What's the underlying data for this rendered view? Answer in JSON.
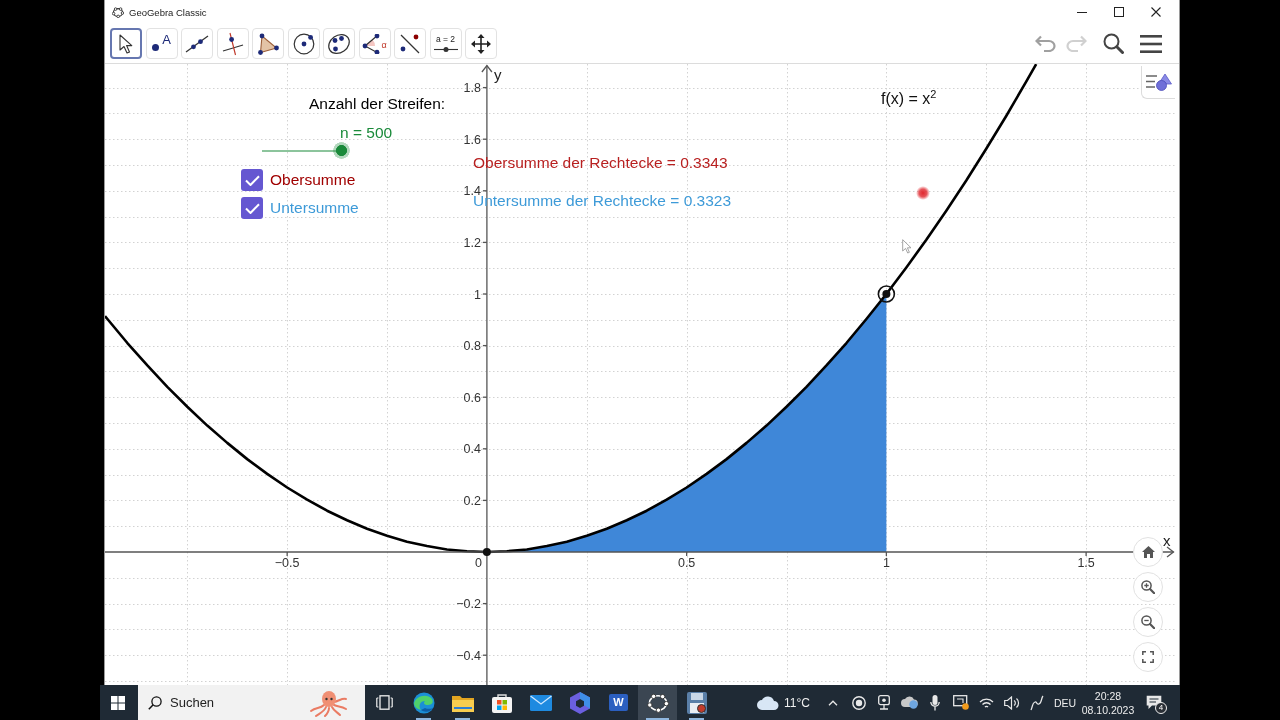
{
  "window": {
    "title": "GeoGebra Classic"
  },
  "toolbar": {
    "tools": [
      {
        "kind": "move",
        "selected": true
      },
      {
        "kind": "point",
        "icon_text": "A",
        "selected": false
      },
      {
        "kind": "line",
        "selected": false
      },
      {
        "kind": "perpendicular",
        "selected": false
      },
      {
        "kind": "polygon",
        "selected": false
      },
      {
        "kind": "circle",
        "selected": false
      },
      {
        "kind": "conic",
        "selected": false
      },
      {
        "kind": "angle",
        "icon_text": "α",
        "selected": false
      },
      {
        "kind": "reflect",
        "selected": false
      },
      {
        "kind": "slider",
        "icon_text": "a = 2",
        "selected": false
      },
      {
        "kind": "pan",
        "selected": false
      }
    ],
    "undo": {
      "disabled": false
    },
    "redo": {
      "disabled": true
    }
  },
  "graphics": {
    "objects": [
      {
        "kind": "text",
        "text": "Anzahl der Streifen:",
        "color": "#000000"
      },
      {
        "kind": "slider",
        "label": "n = 500",
        "level": 1,
        "color": "#1a8a3a"
      },
      {
        "kind": "checkbox",
        "label": "Obersumme",
        "checked": true,
        "color": "#a00000"
      },
      {
        "kind": "checkbox",
        "label": "Untersumme",
        "checked": true,
        "color": "#3d9ad8"
      },
      {
        "kind": "text",
        "text": "Obersumme der Rechtecke = 0.3343",
        "color": "#b82020"
      },
      {
        "kind": "text",
        "text": "Untersumme der Rechtecke = 0.3323",
        "color": "#3d9ad8"
      }
    ],
    "origin_label": "0",
    "chart_data": {
      "type": "line",
      "xlabel": "x",
      "ylabel": "y",
      "grid": true,
      "x": [
        -0.956,
        -0.95,
        -0.9,
        -0.85,
        -0.8,
        -0.75,
        -0.7,
        -0.65,
        -0.6,
        -0.55,
        -0.5,
        -0.45,
        -0.4,
        -0.35,
        -0.3,
        -0.25,
        -0.2,
        -0.15,
        -0.1,
        -0.05,
        0,
        0.05,
        0.1,
        0.15,
        0.2,
        0.25,
        0.3,
        0.35,
        0.4,
        0.45,
        0.5,
        0.55,
        0.6,
        0.65,
        0.7,
        0.75,
        0.8,
        0.85,
        0.9,
        0.95,
        1,
        1.05,
        1.1,
        1.15,
        1.2,
        1.25,
        1.3,
        1.35,
        1.375
      ],
      "series": [
        {
          "name": "f(x) = x$^{2}$",
          "type": "line",
          "color": "#000000",
          "values": [
            0.914,
            0.903,
            0.81,
            0.723,
            0.64,
            0.563,
            0.49,
            0.423,
            0.36,
            0.303,
            0.25,
            0.203,
            0.16,
            0.123,
            0.09,
            0.063,
            0.04,
            0.023,
            0.01,
            0.003,
            0,
            0.003,
            0.01,
            0.023,
            0.04,
            0.063,
            0.09,
            0.123,
            0.16,
            0.203,
            0.25,
            0.303,
            0.36,
            0.423,
            0.49,
            0.563,
            0.64,
            0.723,
            0.81,
            0.903,
            1,
            1.103,
            1.21,
            1.323,
            1.44,
            1.563,
            1.69,
            1.823,
            1.891
          ]
        },
        {
          "type": "area",
          "color": "#3f87d8",
          "values": [
            null,
            null,
            null,
            null,
            null,
            null,
            null,
            null,
            null,
            null,
            null,
            null,
            null,
            null,
            null,
            null,
            null,
            null,
            null,
            null,
            0,
            0.003,
            0.01,
            0.023,
            0.04,
            0.063,
            0.09,
            0.123,
            0.16,
            0.203,
            0.25,
            0.303,
            0.36,
            0.423,
            0.49,
            0.563,
            0.64,
            0.723,
            0.81,
            0.903,
            1,
            null,
            null,
            null,
            null,
            null,
            null,
            null,
            null
          ]
        }
      ],
      "xlim": [
        -0.956,
        1.7225
      ],
      "ylim": [
        -0.5155,
        1.8915
      ],
      "xticks": [
        {
          "value": -0.5,
          "label": "−0.5"
        },
        0.5,
        1,
        1.5
      ],
      "yticks": [
        {
          "value": -0.4,
          "label": "−0.4"
        },
        {
          "value": -0.2,
          "label": "−0.2"
        },
        0.2,
        0.4,
        0.6,
        0.8,
        1,
        1.2,
        1.4,
        1.6,
        1.8
      ]
    }
  },
  "taskbar": {
    "search": {
      "placeholder": "Suchen"
    },
    "apps": [
      {
        "kind": "task_view",
        "running": false,
        "selected": false
      },
      {
        "kind": "browser",
        "running": true,
        "selected": false
      },
      {
        "kind": "folder",
        "running": true,
        "selected": false
      },
      {
        "kind": "store",
        "running": false,
        "selected": false
      },
      {
        "kind": "mail",
        "running": false,
        "selected": false
      },
      {
        "kind": "assistant",
        "running": false,
        "selected": false
      },
      {
        "kind": "word",
        "icon_text": "W",
        "running": false,
        "selected": false
      },
      {
        "kind": "geogebra",
        "running": true,
        "selected": true
      },
      {
        "kind": "recorder",
        "running": true,
        "selected": false
      }
    ],
    "weather": "11°C",
    "language": "DEU",
    "time": "20:28",
    "date": "08.10.2023",
    "notifications": "4"
  }
}
